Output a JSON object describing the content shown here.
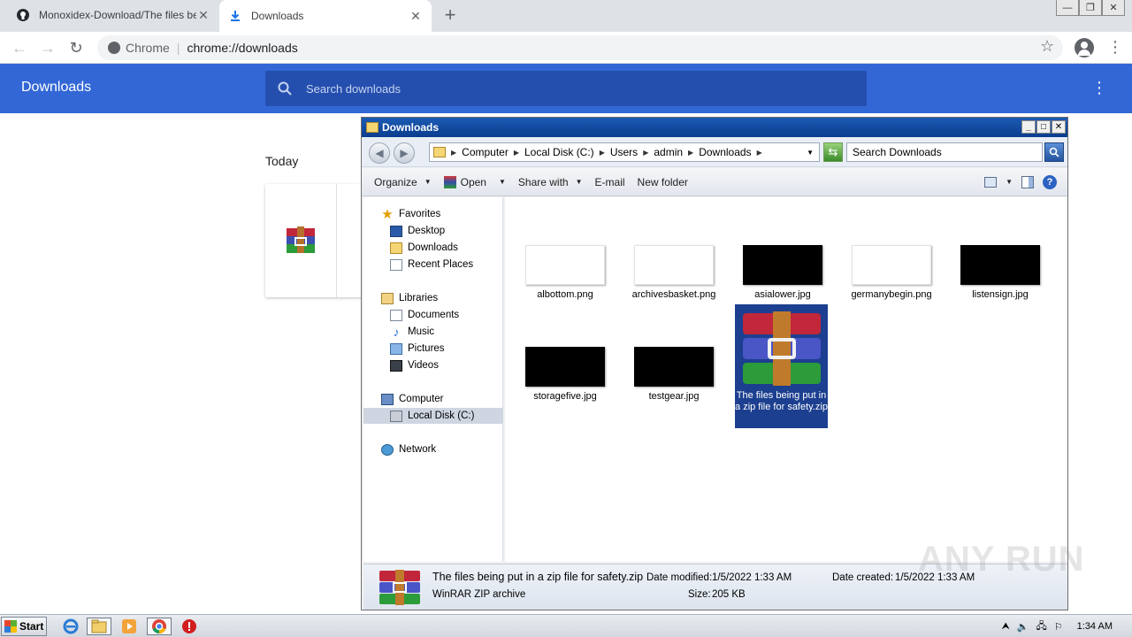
{
  "browser": {
    "tabs": [
      {
        "label": "Monoxidex-Download/The files being",
        "icon": "github-icon"
      },
      {
        "label": "Downloads",
        "icon": "download-icon"
      }
    ],
    "omnibox": {
      "scheme": "Chrome",
      "url": "chrome://downloads"
    }
  },
  "downloads_page": {
    "title": "Downloads",
    "search_placeholder": "Search downloads",
    "section_label": "Today"
  },
  "explorer": {
    "title": "Downloads",
    "breadcrumbs": [
      "Computer",
      "Local Disk (C:)",
      "Users",
      "admin",
      "Downloads"
    ],
    "search_placeholder": "Search Downloads",
    "commands": {
      "organize": "Organize",
      "open": "Open",
      "share": "Share with",
      "email": "E-mail",
      "new_folder": "New folder"
    },
    "nav": {
      "favorites": "Favorites",
      "desktop": "Desktop",
      "downloads": "Downloads",
      "recent": "Recent Places",
      "libraries": "Libraries",
      "documents": "Documents",
      "music": "Music",
      "pictures": "Pictures",
      "videos": "Videos",
      "computer": "Computer",
      "local_disk": "Local Disk (C:)",
      "network": "Network"
    },
    "files": [
      {
        "name": "albottom.png",
        "thumb": "white"
      },
      {
        "name": "archivesbasket.png",
        "thumb": "white"
      },
      {
        "name": "asialower.jpg",
        "thumb": "black"
      },
      {
        "name": "germanybegin.png",
        "thumb": "white"
      },
      {
        "name": "listensign.jpg",
        "thumb": "black"
      },
      {
        "name": "storagefive.jpg",
        "thumb": "black"
      },
      {
        "name": "testgear.jpg",
        "thumb": "black"
      },
      {
        "name": "The files being put in a zip file for safety.zip",
        "thumb": "winrar"
      }
    ],
    "status": {
      "filename": "The files being put in a zip file for safety.zip",
      "filetype": "WinRAR ZIP archive",
      "date_modified_label": "Date modified:",
      "date_modified": "1/5/2022 1:33 AM",
      "size_label": "Size:",
      "size": "205 KB",
      "date_created_label": "Date created:",
      "date_created": "1/5/2022 1:33 AM"
    }
  },
  "taskbar": {
    "start": "Start",
    "clock": "1:34 AM"
  },
  "watermark": "ANY RUN",
  "colors": {
    "chrome_header": "#3367d6",
    "selection": "#1c3f8f"
  }
}
